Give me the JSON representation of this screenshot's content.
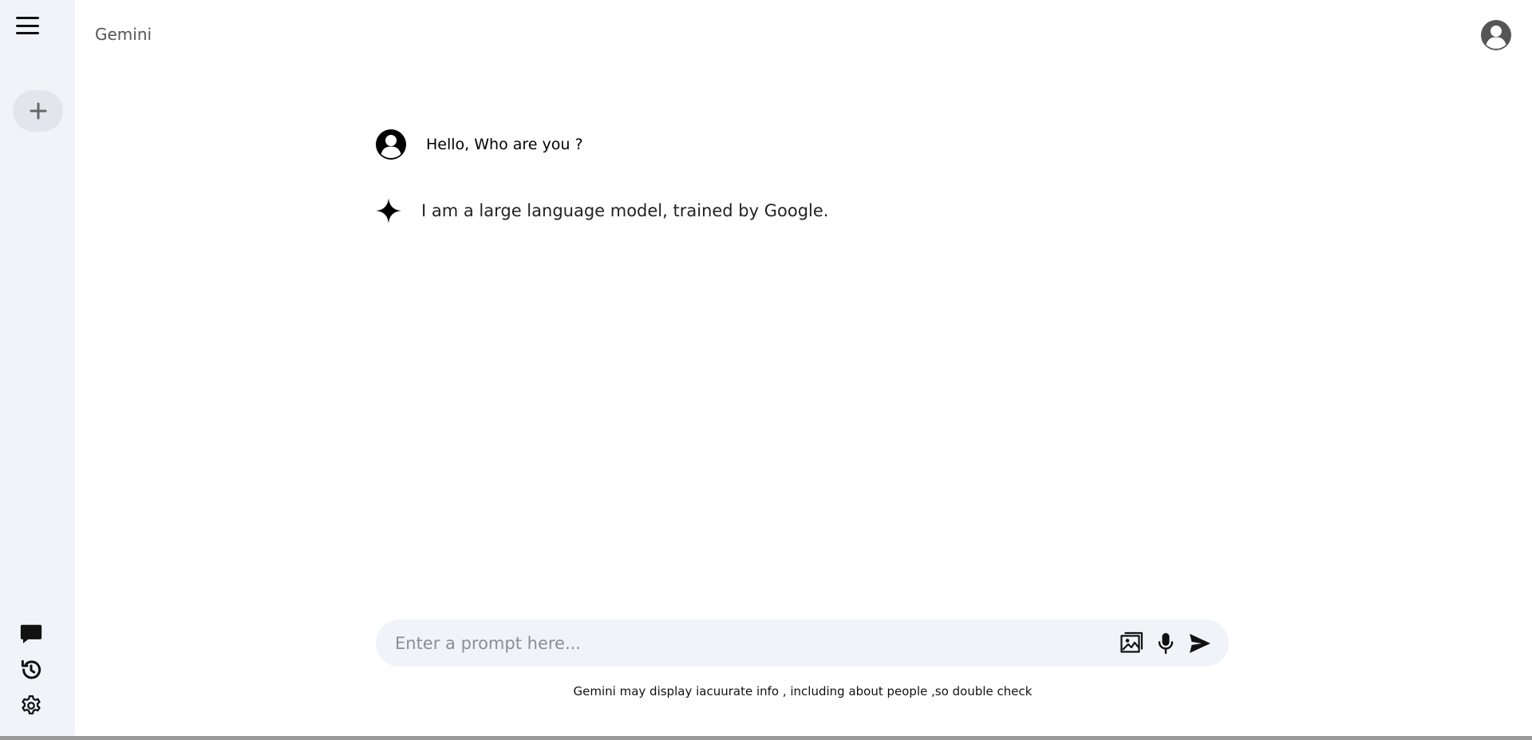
{
  "app": {
    "title": "Gemini"
  },
  "sidebar": {
    "menu_icon": "hamburger-icon",
    "new_chat_icon": "plus-icon",
    "bottom_icons": [
      "chat-bubble-icon",
      "history-icon",
      "gear-icon"
    ]
  },
  "header": {
    "avatar_icon": "user-circle-icon"
  },
  "conversation": {
    "messages": [
      {
        "role": "user",
        "icon": "user-circle-icon",
        "text": "Hello, Who are you ?"
      },
      {
        "role": "assistant",
        "icon": "sparkle-icon",
        "text": "I am a large language model, trained by Google."
      }
    ]
  },
  "prompt": {
    "placeholder": "Enter a prompt here...",
    "value": "",
    "icons": [
      "image-icon",
      "microphone-icon",
      "send-icon"
    ]
  },
  "disclaimer": "Gemini may display iacuurate info , including about people ,so double check",
  "colors": {
    "sidebar_bg": "#f0f3f8",
    "new_chat_bg": "#e2e6ec",
    "prompt_bg": "#f0f3f8"
  }
}
